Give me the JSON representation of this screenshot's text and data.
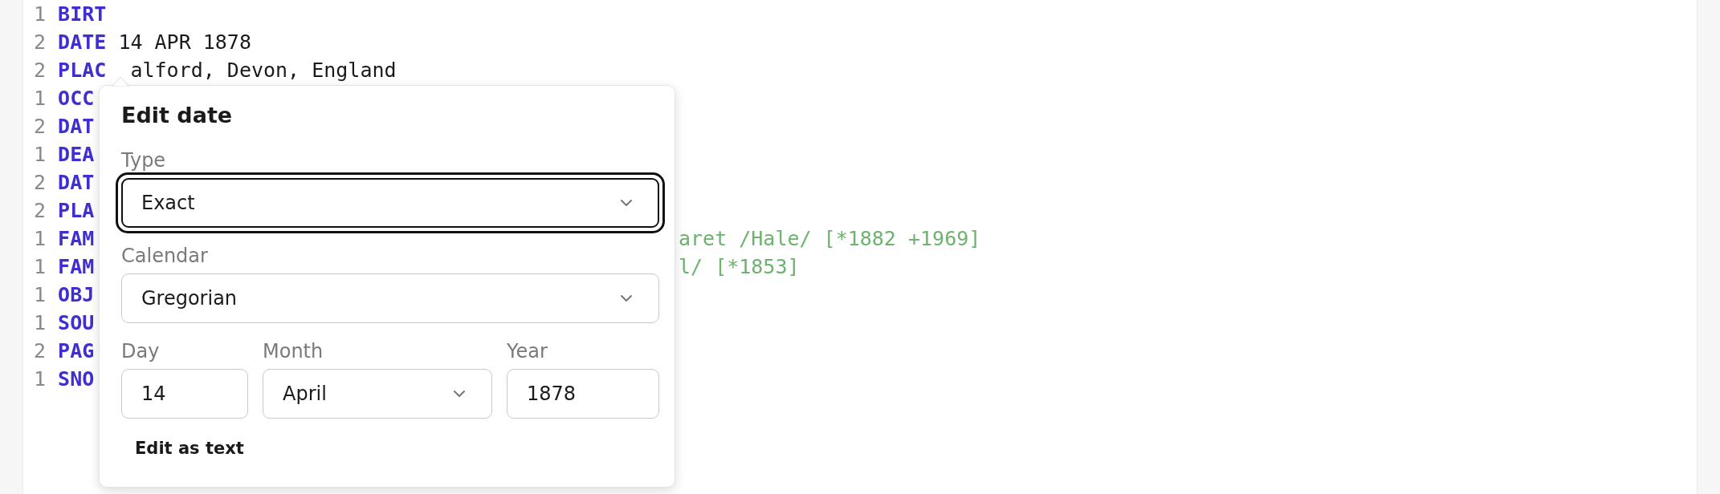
{
  "editor": {
    "lines": [
      {
        "number": "1",
        "tag": "BIRT"
      },
      {
        "number": "2",
        "tag": "DATE",
        "value": "14 APR 1878"
      },
      {
        "number": "2",
        "tag": "PLAC",
        "value": "alford, Devon, England"
      },
      {
        "number": "1",
        "tag": "OCC"
      },
      {
        "number": "2",
        "tag": "DAT"
      },
      {
        "number": "1",
        "tag": "DEA"
      },
      {
        "number": "2",
        "tag": "DAT"
      },
      {
        "number": "2",
        "tag": "PLA"
      },
      {
        "number": "1",
        "tag": "FAM",
        "reference": "aret /Hale/ [*1882 +1969]"
      },
      {
        "number": "1",
        "tag": "FAM",
        "reference": "l/ [*1853]"
      },
      {
        "number": "1",
        "tag": "OBJ"
      },
      {
        "number": "1",
        "tag": "SOU"
      },
      {
        "number": "2",
        "tag": "PAG"
      },
      {
        "number": "1",
        "tag": "SNO"
      }
    ]
  },
  "popover": {
    "title": "Edit date",
    "rows": [
      [
        {
          "kind": "select",
          "label": "Type",
          "value": "Exact",
          "focused": true
        }
      ],
      [
        {
          "kind": "select",
          "label": "Calendar",
          "value": "Gregorian",
          "focused": false
        }
      ],
      [
        {
          "kind": "input",
          "label": "Day",
          "value": "14",
          "focused": false
        },
        {
          "kind": "select",
          "label": "Month",
          "value": "April",
          "focused": false
        },
        {
          "kind": "input",
          "label": "Year",
          "value": "1878",
          "focused": false
        }
      ]
    ],
    "action": "Edit as text"
  }
}
